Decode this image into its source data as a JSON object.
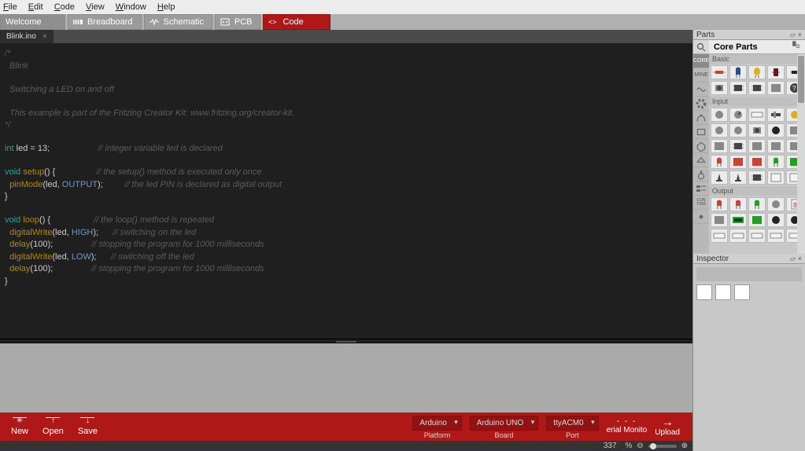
{
  "menu": {
    "items": [
      "File",
      "Edit",
      "Code",
      "View",
      "Window",
      "Help"
    ]
  },
  "toolbar": {
    "welcome": "Welcome",
    "breadboard": "Breadboard",
    "schematic": "Schematic",
    "pcb": "PCB",
    "code": "Code"
  },
  "tab": {
    "name": "Blink.ino"
  },
  "code_lines": [
    {
      "t": "cmt",
      "s": "/*"
    },
    {
      "t": "cmt",
      "s": "  Blink"
    },
    {
      "t": "blank",
      "s": ""
    },
    {
      "t": "cmt",
      "s": "  Switching a LED on and off"
    },
    {
      "t": "blank",
      "s": ""
    },
    {
      "t": "cmt",
      "s": "  This example is part of the Fritzing Creator Kit: www.fritzing.org/creator-kit."
    },
    {
      "t": "cmt",
      "s": "*/"
    },
    {
      "t": "blank",
      "s": ""
    },
    {
      "t": "code",
      "parts": [
        [
          "kw",
          "int"
        ],
        [
          "ws",
          " led = "
        ],
        [
          "num",
          "13"
        ],
        [
          "ws",
          ";                    "
        ],
        [
          "cmt",
          "// integer variable led is declared"
        ]
      ]
    },
    {
      "t": "blank",
      "s": ""
    },
    {
      "t": "code",
      "parts": [
        [
          "kw",
          "void"
        ],
        [
          "ws",
          " "
        ],
        [
          "fn",
          "setup"
        ],
        [
          "ws",
          "() {                 "
        ],
        [
          "cmt",
          "// the setup() method is executed only once"
        ]
      ]
    },
    {
      "t": "code",
      "parts": [
        [
          "ws",
          "  "
        ],
        [
          "call",
          "pinMode"
        ],
        [
          "ws",
          "(led, "
        ],
        [
          "const",
          "OUTPUT"
        ],
        [
          "ws",
          ");         "
        ],
        [
          "cmt",
          "// the led PIN is declared as digital output"
        ]
      ]
    },
    {
      "t": "code",
      "parts": [
        [
          "ws",
          "}"
        ]
      ]
    },
    {
      "t": "blank",
      "s": ""
    },
    {
      "t": "code",
      "parts": [
        [
          "kw",
          "void"
        ],
        [
          "ws",
          " "
        ],
        [
          "fn",
          "loop"
        ],
        [
          "ws",
          "() {                  "
        ],
        [
          "cmt",
          "// the loop() method is repeated"
        ]
      ]
    },
    {
      "t": "code",
      "parts": [
        [
          "ws",
          "  "
        ],
        [
          "call",
          "digitalWrite"
        ],
        [
          "ws",
          "(led, "
        ],
        [
          "const",
          "HIGH"
        ],
        [
          "ws",
          ");      "
        ],
        [
          "cmt",
          "// switching on the led"
        ]
      ]
    },
    {
      "t": "code",
      "parts": [
        [
          "ws",
          "  "
        ],
        [
          "call",
          "delay"
        ],
        [
          "ws",
          "("
        ],
        [
          "num",
          "100"
        ],
        [
          "ws",
          ");                "
        ],
        [
          "cmt",
          "// stopping the program for 1000 milliseconds"
        ]
      ]
    },
    {
      "t": "code",
      "parts": [
        [
          "ws",
          "  "
        ],
        [
          "call",
          "digitalWrite"
        ],
        [
          "ws",
          "(led, "
        ],
        [
          "const",
          "LOW"
        ],
        [
          "ws",
          ");      "
        ],
        [
          "cmt",
          "// switching off the led"
        ]
      ]
    },
    {
      "t": "code",
      "parts": [
        [
          "ws",
          "  "
        ],
        [
          "call",
          "delay"
        ],
        [
          "ws",
          "("
        ],
        [
          "num",
          "100"
        ],
        [
          "ws",
          ");                "
        ],
        [
          "cmt",
          "// stopping the program for 1000 milliseconds"
        ]
      ]
    },
    {
      "t": "code",
      "parts": [
        [
          "ws",
          "}"
        ]
      ]
    }
  ],
  "bottom": {
    "new": "New",
    "open": "Open",
    "save": "Save",
    "platform_val": "Arduino",
    "platform_lbl": "Platform",
    "board_val": "Arduino UNO",
    "board_lbl": "Board",
    "port_val": "ttyACM0",
    "port_lbl": "Port",
    "serial": "erial Monito",
    "upload": "Upload"
  },
  "status": {
    "zoom": "337",
    "pct": "%"
  },
  "parts": {
    "panel": "Parts",
    "core_title": "Core Parts",
    "sections": [
      "Basic",
      "Input",
      "Output"
    ],
    "strip": [
      "SEARCH",
      "CORE",
      "MINE",
      "ARDU",
      "LOOP",
      "WIFI",
      "PAD",
      "HEX",
      "SHIELD",
      "MIC",
      "FLAG",
      "CONTRIB",
      "DOT"
    ],
    "strip_core": "CORE",
    "strip_mine": "MINE"
  },
  "inspector": {
    "panel": "Inspector"
  }
}
